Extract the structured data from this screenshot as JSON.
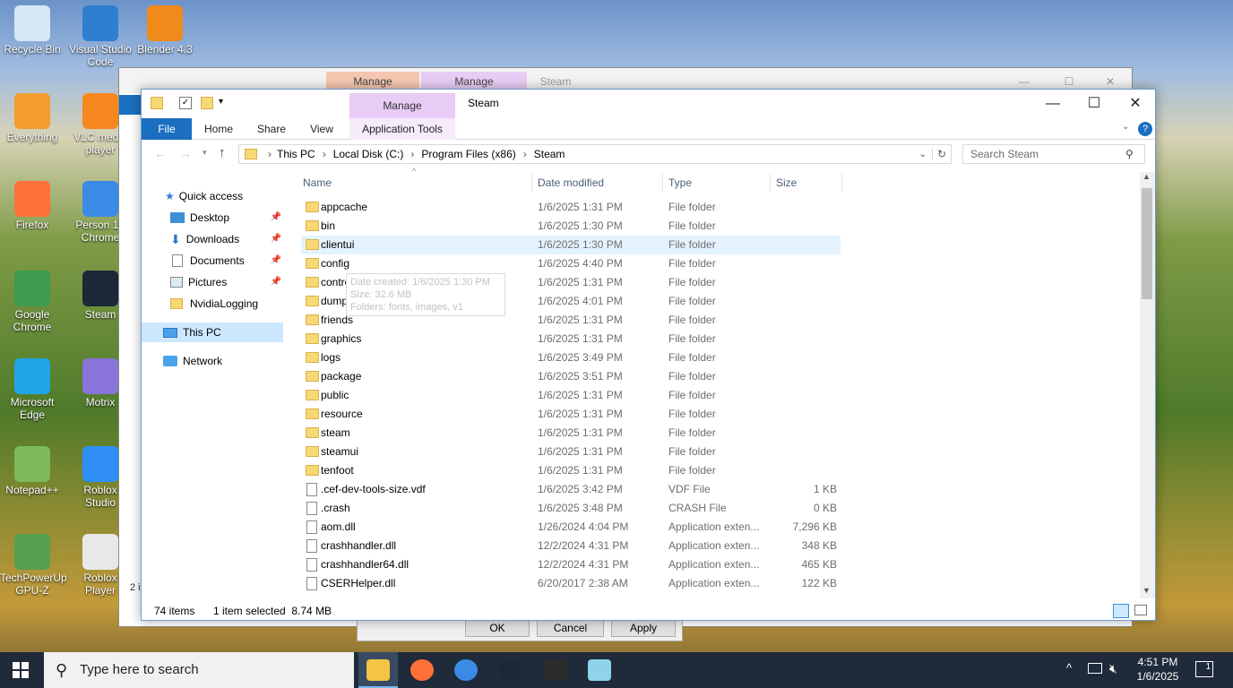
{
  "desktop": {
    "icons": [
      {
        "label": "Recycle Bin",
        "color": "#d6e7f5"
      },
      {
        "label": "Visual Studio Code",
        "color": "#2f7fd1"
      },
      {
        "label": "Blender 4.3",
        "color": "#f08a1a"
      },
      {
        "label": "Everything",
        "color": "#f39c2f"
      },
      {
        "label": "VLC media player",
        "color": "#f6881f"
      },
      {
        "label": "Firefox",
        "color": "#ff7139"
      },
      {
        "label": "Person 1 - Chrome",
        "color": "#3a8be6"
      },
      {
        "label": "Google Chrome",
        "color": "#3d9b4d"
      },
      {
        "label": "Steam",
        "color": "#1b2838"
      },
      {
        "label": "Microsoft Edge",
        "color": "#1fa6e8"
      },
      {
        "label": "Motrix",
        "color": "#8a74d9"
      },
      {
        "label": "Notepad++",
        "color": "#7cba59"
      },
      {
        "label": "Roblox Studio",
        "color": "#2e8ef5"
      },
      {
        "label": "TechPowerUp GPU-Z",
        "color": "#57a04f"
      },
      {
        "label": "Roblox Player",
        "color": "#e8e8e8"
      }
    ]
  },
  "bgwindow": {
    "tab1": "Manage",
    "tab2": "Manage",
    "title": "Steam",
    "left_text": "2 i"
  },
  "dialog": {
    "ok": "OK",
    "cancel": "Cancel",
    "apply": "Apply"
  },
  "window": {
    "title": "Steam",
    "context_tab": "Manage",
    "ribbon": {
      "file": "File",
      "home": "Home",
      "share": "Share",
      "view": "View",
      "app_tools": "Application Tools"
    },
    "controls": {
      "minimize": "—",
      "maximize": "☐",
      "close": "✕"
    },
    "address": {
      "path": [
        "This PC",
        "Local Disk (C:)",
        "Program Files (x86)",
        "Steam"
      ]
    },
    "search_placeholder": "Search Steam",
    "nav": {
      "quick_access": "Quick access",
      "desktop": "Desktop",
      "downloads": "Downloads",
      "documents": "Documents",
      "pictures": "Pictures",
      "nvidia": "NvidiaLogging",
      "this_pc": "This PC",
      "network": "Network"
    },
    "columns": {
      "name": "Name",
      "date": "Date modified",
      "type": "Type",
      "size": "Size"
    },
    "rows": [
      {
        "name": "appcache",
        "date": "1/6/2025 1:31 PM",
        "type": "File folder",
        "size": "",
        "kind": "folder"
      },
      {
        "name": "bin",
        "date": "1/6/2025 1:30 PM",
        "type": "File folder",
        "size": "",
        "kind": "folder"
      },
      {
        "name": "clientui",
        "date": "1/6/2025 1:30 PM",
        "type": "File folder",
        "size": "",
        "kind": "folder"
      },
      {
        "name": "config",
        "date": "1/6/2025 4:40 PM",
        "type": "File folder",
        "size": "",
        "kind": "folder"
      },
      {
        "name": "controller_base",
        "date": "1/6/2025 1:31 PM",
        "type": "File folder",
        "size": "",
        "kind": "folder"
      },
      {
        "name": "dumps",
        "date": "1/6/2025 4:01 PM",
        "type": "File folder",
        "size": "",
        "kind": "folder"
      },
      {
        "name": "friends",
        "date": "1/6/2025 1:31 PM",
        "type": "File folder",
        "size": "",
        "kind": "folder"
      },
      {
        "name": "graphics",
        "date": "1/6/2025 1:31 PM",
        "type": "File folder",
        "size": "",
        "kind": "folder"
      },
      {
        "name": "logs",
        "date": "1/6/2025 3:49 PM",
        "type": "File folder",
        "size": "",
        "kind": "folder"
      },
      {
        "name": "package",
        "date": "1/6/2025 3:51 PM",
        "type": "File folder",
        "size": "",
        "kind": "folder"
      },
      {
        "name": "public",
        "date": "1/6/2025 1:31 PM",
        "type": "File folder",
        "size": "",
        "kind": "folder"
      },
      {
        "name": "resource",
        "date": "1/6/2025 1:31 PM",
        "type": "File folder",
        "size": "",
        "kind": "folder"
      },
      {
        "name": "steam",
        "date": "1/6/2025 1:31 PM",
        "type": "File folder",
        "size": "",
        "kind": "folder"
      },
      {
        "name": "steamui",
        "date": "1/6/2025 1:31 PM",
        "type": "File folder",
        "size": "",
        "kind": "folder"
      },
      {
        "name": "tenfoot",
        "date": "1/6/2025 1:31 PM",
        "type": "File folder",
        "size": "",
        "kind": "folder"
      },
      {
        "name": ".cef-dev-tools-size.vdf",
        "date": "1/6/2025 3:42 PM",
        "type": "VDF File",
        "size": "1 KB",
        "kind": "file"
      },
      {
        "name": ".crash",
        "date": "1/6/2025 3:48 PM",
        "type": "CRASH File",
        "size": "0 KB",
        "kind": "file"
      },
      {
        "name": "aom.dll",
        "date": "1/26/2024 4:04 PM",
        "type": "Application exten...",
        "size": "7,296 KB",
        "kind": "file"
      },
      {
        "name": "crashhandler.dll",
        "date": "12/2/2024 4:31 PM",
        "type": "Application exten...",
        "size": "348 KB",
        "kind": "file"
      },
      {
        "name": "crashhandler64.dll",
        "date": "12/2/2024 4:31 PM",
        "type": "Application exten...",
        "size": "465 KB",
        "kind": "file"
      },
      {
        "name": "CSERHelper.dll",
        "date": "6/20/2017 2:38 AM",
        "type": "Application exten...",
        "size": "122 KB",
        "kind": "file"
      }
    ],
    "tooltip": {
      "line1": "Date created: 1/6/2025 1:30 PM",
      "line2": "Size: 32.6 MB",
      "line3": "Folders: fonts, images, v1"
    },
    "status": {
      "count": "74 items",
      "selected": "1 item selected  8.74 MB"
    }
  },
  "taskbar": {
    "search": "Type here to search",
    "time": "4:51 PM",
    "date": "1/6/2025",
    "notifications": "1",
    "apps": [
      {
        "name": "file-explorer",
        "color": "#f4c542"
      },
      {
        "name": "firefox",
        "color": "#ff7139"
      },
      {
        "name": "chrome",
        "color": "#3a8be6"
      },
      {
        "name": "steam",
        "color": "#1b2838"
      },
      {
        "name": "terminal",
        "color": "#2b2b2b"
      },
      {
        "name": "notepad",
        "color": "#8fd3e8"
      }
    ]
  }
}
